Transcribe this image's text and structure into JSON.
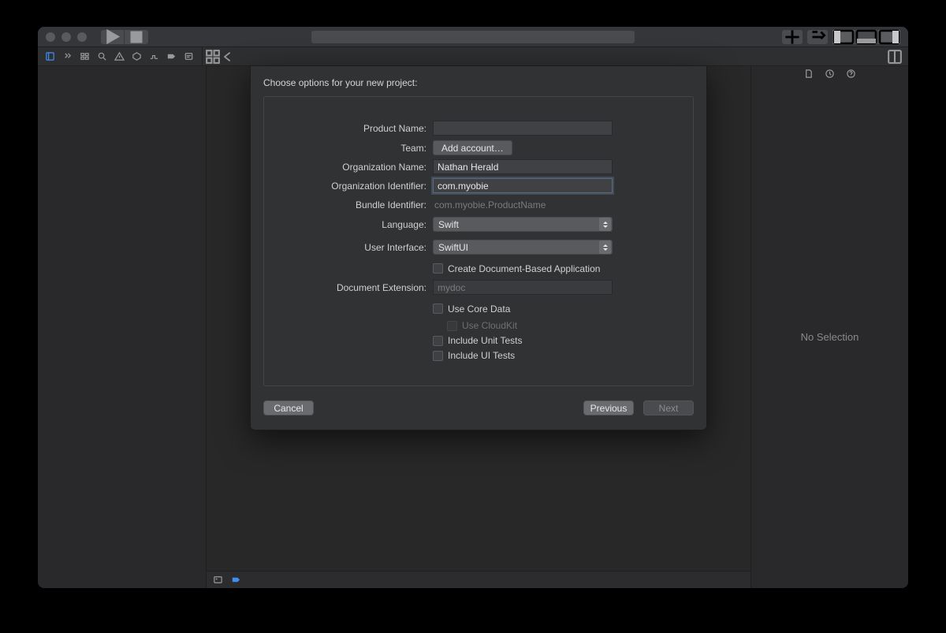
{
  "sheet": {
    "title": "Choose options for your new project:",
    "labels": {
      "product_name": "Product Name:",
      "team": "Team:",
      "org_name": "Organization Name:",
      "org_id": "Organization Identifier:",
      "bundle_id": "Bundle Identifier:",
      "language": "Language:",
      "ui": "User Interface:",
      "doc_ext": "Document Extension:"
    },
    "values": {
      "product_name": "",
      "team_button": "Add account…",
      "org_name": "Nathan Herald",
      "org_id": "com.myobie",
      "bundle_id": "com.myobie.ProductName",
      "language": "Swift",
      "ui": "SwiftUI",
      "doc_ext_placeholder": "mydoc"
    },
    "checks": {
      "doc_based": "Create Document-Based Application",
      "core_data": "Use Core Data",
      "cloudkit": "Use CloudKit",
      "unit_tests": "Include Unit Tests",
      "ui_tests": "Include UI Tests"
    },
    "buttons": {
      "cancel": "Cancel",
      "previous": "Previous",
      "next": "Next"
    }
  },
  "inspector": {
    "no_selection": "No Selection"
  }
}
